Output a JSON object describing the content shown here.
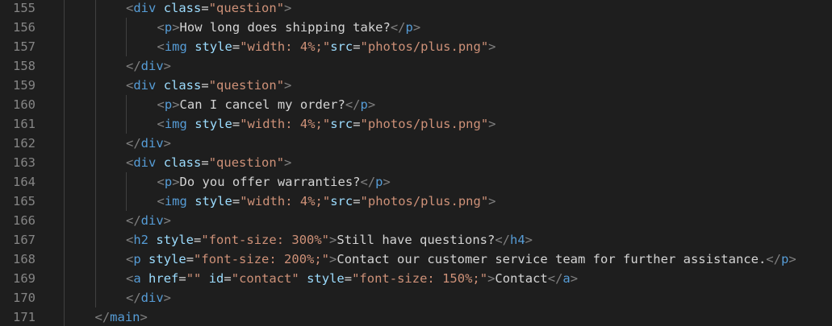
{
  "theme": {
    "background": "#1e1e1e",
    "line_number": "#858585",
    "tag": "#569cd6",
    "bracket": "#808080",
    "attribute": "#9cdcfe",
    "string": "#ce9178",
    "text": "#d4d4d4",
    "indent_guide": "#404040"
  },
  "lines": [
    {
      "num": "155",
      "indent": 4,
      "tokens": [
        {
          "t": "<",
          "k": "bracket"
        },
        {
          "t": "div",
          "k": "tag"
        },
        {
          "t": " ",
          "k": "text"
        },
        {
          "t": "class",
          "k": "attr"
        },
        {
          "t": "=",
          "k": "eq"
        },
        {
          "t": "\"question\"",
          "k": "str"
        },
        {
          "t": ">",
          "k": "bracket"
        }
      ]
    },
    {
      "num": "156",
      "indent": 5,
      "tokens": [
        {
          "t": "<",
          "k": "bracket"
        },
        {
          "t": "p",
          "k": "tag"
        },
        {
          "t": ">",
          "k": "bracket"
        },
        {
          "t": "How long does shipping take?",
          "k": "text"
        },
        {
          "t": "</",
          "k": "bracket"
        },
        {
          "t": "p",
          "k": "tag"
        },
        {
          "t": ">",
          "k": "bracket"
        }
      ]
    },
    {
      "num": "157",
      "indent": 5,
      "tokens": [
        {
          "t": "<",
          "k": "bracket"
        },
        {
          "t": "img",
          "k": "tag"
        },
        {
          "t": " ",
          "k": "text"
        },
        {
          "t": "style",
          "k": "attr"
        },
        {
          "t": "=",
          "k": "eq"
        },
        {
          "t": "\"width: 4%;\"",
          "k": "str"
        },
        {
          "t": "src",
          "k": "attr"
        },
        {
          "t": "=",
          "k": "eq"
        },
        {
          "t": "\"photos/plus.png\"",
          "k": "str"
        },
        {
          "t": ">",
          "k": "bracket"
        }
      ]
    },
    {
      "num": "158",
      "indent": 4,
      "tokens": [
        {
          "t": "</",
          "k": "bracket"
        },
        {
          "t": "div",
          "k": "tag"
        },
        {
          "t": ">",
          "k": "bracket"
        }
      ]
    },
    {
      "num": "159",
      "indent": 4,
      "tokens": [
        {
          "t": "<",
          "k": "bracket"
        },
        {
          "t": "div",
          "k": "tag"
        },
        {
          "t": " ",
          "k": "text"
        },
        {
          "t": "class",
          "k": "attr"
        },
        {
          "t": "=",
          "k": "eq"
        },
        {
          "t": "\"question\"",
          "k": "str"
        },
        {
          "t": ">",
          "k": "bracket"
        }
      ]
    },
    {
      "num": "160",
      "indent": 5,
      "tokens": [
        {
          "t": "<",
          "k": "bracket"
        },
        {
          "t": "p",
          "k": "tag"
        },
        {
          "t": ">",
          "k": "bracket"
        },
        {
          "t": "Can I cancel my order?",
          "k": "text"
        },
        {
          "t": "</",
          "k": "bracket"
        },
        {
          "t": "p",
          "k": "tag"
        },
        {
          "t": ">",
          "k": "bracket"
        }
      ]
    },
    {
      "num": "161",
      "indent": 5,
      "tokens": [
        {
          "t": "<",
          "k": "bracket"
        },
        {
          "t": "img",
          "k": "tag"
        },
        {
          "t": " ",
          "k": "text"
        },
        {
          "t": "style",
          "k": "attr"
        },
        {
          "t": "=",
          "k": "eq"
        },
        {
          "t": "\"width: 4%;\"",
          "k": "str"
        },
        {
          "t": "src",
          "k": "attr"
        },
        {
          "t": "=",
          "k": "eq"
        },
        {
          "t": "\"photos/plus.png\"",
          "k": "str"
        },
        {
          "t": ">",
          "k": "bracket"
        }
      ]
    },
    {
      "num": "162",
      "indent": 4,
      "tokens": [
        {
          "t": "</",
          "k": "bracket"
        },
        {
          "t": "div",
          "k": "tag"
        },
        {
          "t": ">",
          "k": "bracket"
        }
      ]
    },
    {
      "num": "163",
      "indent": 4,
      "tokens": [
        {
          "t": "<",
          "k": "bracket"
        },
        {
          "t": "div",
          "k": "tag"
        },
        {
          "t": " ",
          "k": "text"
        },
        {
          "t": "class",
          "k": "attr"
        },
        {
          "t": "=",
          "k": "eq"
        },
        {
          "t": "\"question\"",
          "k": "str"
        },
        {
          "t": ">",
          "k": "bracket"
        }
      ]
    },
    {
      "num": "164",
      "indent": 5,
      "tokens": [
        {
          "t": "<",
          "k": "bracket"
        },
        {
          "t": "p",
          "k": "tag"
        },
        {
          "t": ">",
          "k": "bracket"
        },
        {
          "t": "Do you offer warranties?",
          "k": "text"
        },
        {
          "t": "</",
          "k": "bracket"
        },
        {
          "t": "p",
          "k": "tag"
        },
        {
          "t": ">",
          "k": "bracket"
        }
      ]
    },
    {
      "num": "165",
      "indent": 5,
      "tokens": [
        {
          "t": "<",
          "k": "bracket"
        },
        {
          "t": "img",
          "k": "tag"
        },
        {
          "t": " ",
          "k": "text"
        },
        {
          "t": "style",
          "k": "attr"
        },
        {
          "t": "=",
          "k": "eq"
        },
        {
          "t": "\"width: 4%;\"",
          "k": "str"
        },
        {
          "t": "src",
          "k": "attr"
        },
        {
          "t": "=",
          "k": "eq"
        },
        {
          "t": "\"photos/plus.png\"",
          "k": "str"
        },
        {
          "t": ">",
          "k": "bracket"
        }
      ]
    },
    {
      "num": "166",
      "indent": 4,
      "tokens": [
        {
          "t": "</",
          "k": "bracket"
        },
        {
          "t": "div",
          "k": "tag"
        },
        {
          "t": ">",
          "k": "bracket"
        }
      ]
    },
    {
      "num": "167",
      "indent": 4,
      "tokens": [
        {
          "t": "<",
          "k": "bracket"
        },
        {
          "t": "h2",
          "k": "tag"
        },
        {
          "t": " ",
          "k": "text"
        },
        {
          "t": "style",
          "k": "attr"
        },
        {
          "t": "=",
          "k": "eq"
        },
        {
          "t": "\"font-size: 300%\"",
          "k": "str"
        },
        {
          "t": ">",
          "k": "bracket"
        },
        {
          "t": "Still have questions?",
          "k": "text"
        },
        {
          "t": "</",
          "k": "bracket"
        },
        {
          "t": "h4",
          "k": "tag"
        },
        {
          "t": ">",
          "k": "bracket"
        }
      ]
    },
    {
      "num": "168",
      "indent": 4,
      "tokens": [
        {
          "t": "<",
          "k": "bracket"
        },
        {
          "t": "p",
          "k": "tag"
        },
        {
          "t": " ",
          "k": "text"
        },
        {
          "t": "style",
          "k": "attr"
        },
        {
          "t": "=",
          "k": "eq"
        },
        {
          "t": "\"font-size: 200%;\"",
          "k": "str"
        },
        {
          "t": ">",
          "k": "bracket"
        },
        {
          "t": "Contact our customer service team for further assistance.",
          "k": "text"
        },
        {
          "t": "</",
          "k": "bracket"
        },
        {
          "t": "p",
          "k": "tag"
        },
        {
          "t": ">",
          "k": "bracket"
        }
      ]
    },
    {
      "num": "169",
      "indent": 4,
      "tokens": [
        {
          "t": "<",
          "k": "bracket"
        },
        {
          "t": "a",
          "k": "tag"
        },
        {
          "t": " ",
          "k": "text"
        },
        {
          "t": "href",
          "k": "attr"
        },
        {
          "t": "=",
          "k": "eq"
        },
        {
          "t": "\"\"",
          "k": "str"
        },
        {
          "t": " ",
          "k": "text"
        },
        {
          "t": "id",
          "k": "attr"
        },
        {
          "t": "=",
          "k": "eq"
        },
        {
          "t": "\"contact\"",
          "k": "str"
        },
        {
          "t": " ",
          "k": "text"
        },
        {
          "t": "style",
          "k": "attr"
        },
        {
          "t": "=",
          "k": "eq"
        },
        {
          "t": "\"font-size: 150%;\"",
          "k": "str"
        },
        {
          "t": ">",
          "k": "bracket"
        },
        {
          "t": "Contact",
          "k": "text"
        },
        {
          "t": "</",
          "k": "bracket"
        },
        {
          "t": "a",
          "k": "tag"
        },
        {
          "t": ">",
          "k": "bracket"
        }
      ]
    },
    {
      "num": "170",
      "indent": 4,
      "tokens": [
        {
          "t": "</",
          "k": "bracket"
        },
        {
          "t": "div",
          "k": "tag"
        },
        {
          "t": ">",
          "k": "bracket"
        }
      ]
    },
    {
      "num": "171",
      "indent": 3,
      "tokens": [
        {
          "t": "</",
          "k": "bracket"
        },
        {
          "t": "main",
          "k": "tag"
        },
        {
          "t": ">",
          "k": "bracket"
        }
      ]
    }
  ]
}
